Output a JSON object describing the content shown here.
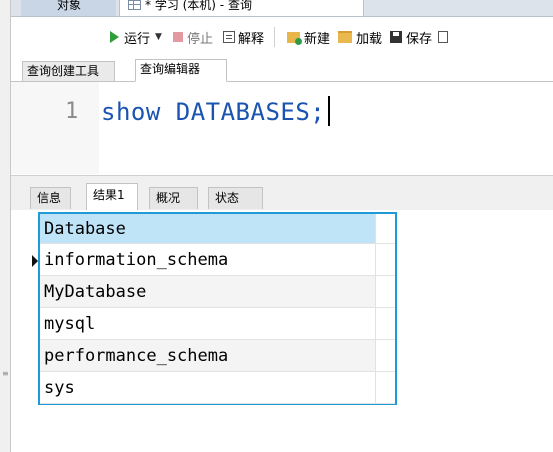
{
  "tabs": {
    "objects_label": "对象",
    "query_label": "* 学习 (本机) - 查询"
  },
  "toolbar": {
    "run_label": "运行",
    "stop_label": "停止",
    "explain_label": "解释",
    "new_label": "新建",
    "load_label": "加载",
    "save_label": "保存",
    "more_label": "..."
  },
  "editor_tabs": {
    "builder_label": "查询创建工具",
    "editor_label": "查询编辑器"
  },
  "editor": {
    "line_number": "1",
    "code": "show DATABASES;"
  },
  "result_tabs": {
    "info": "信息",
    "result1": "结果1",
    "profile": "概况",
    "status": "状态"
  },
  "results": {
    "column": "Database",
    "rows": [
      "information_schema",
      "MyDatabase",
      "mysql",
      "performance_schema",
      "sys"
    ]
  },
  "colors": {
    "accent_border": "#1e9bd7",
    "header_bg": "#bfe3f7",
    "code_text": "#1a54b0",
    "run_green": "#2e9d3a"
  }
}
